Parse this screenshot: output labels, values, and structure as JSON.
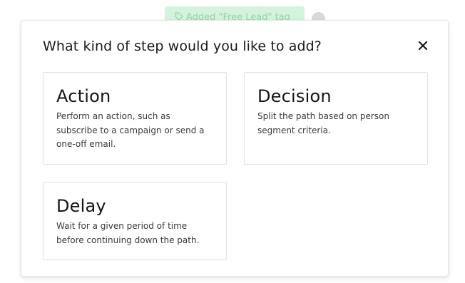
{
  "background": {
    "toast_text": "Added \"Free Lead\" tag"
  },
  "modal": {
    "title": "What kind of step would you like to add?",
    "close_glyph": "close-icon",
    "options": [
      {
        "title": "Action",
        "description": "Perform an action, such as subscribe to a campaign or send a one-off email."
      },
      {
        "title": "Decision",
        "description": "Split the path based on person segment criteria."
      },
      {
        "title": "Delay",
        "description": "Wait for a given period of time before continuing down the path."
      }
    ]
  },
  "colors": {
    "toast_bg": "#d4f3dc",
    "toast_text": "#8fd6a3",
    "card_border": "#e2e2e2",
    "text": "#1a1a1a"
  }
}
